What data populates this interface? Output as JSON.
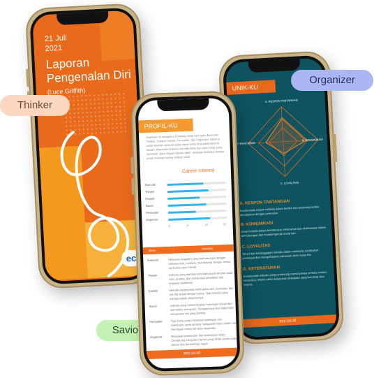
{
  "pills": {
    "thinker": "Thinker",
    "organizer": "Organizer",
    "savior": "Savior"
  },
  "cover": {
    "date_line1": "21 Juli",
    "date_line2": "2021",
    "title_line1": "Laporan",
    "title_line2": "Pengenalan Diri",
    "subtitle": "(Luce Griffith)",
    "logo": "ecc"
  },
  "profile": {
    "header": "PROFIL-KU",
    "intro": "Asesmen ini mengukur 6 bidang minat karir yaitu Executor, Thinker, Creator, Savior, Persuader, dan Organizer. Skormu untuk keenam area tersebut dapat kamu lihat pada tabel di bawah. Mayoritas individu memiliki lebih dari satu minat yang menonjol. Baca bagian bawah tabel, terdapat deskripsi singkat untuk masing-masing bidang minat.",
    "chart_title": "Career Interest",
    "chart_rows": [
      {
        "label": "Executor",
        "value": 0.62
      },
      {
        "label": "Thinker",
        "value": 0.7
      },
      {
        "label": "Creator",
        "value": 0.55
      },
      {
        "label": "Savior",
        "value": 0.66
      },
      {
        "label": "Persuader",
        "value": 0.48
      },
      {
        "label": "Organizer",
        "value": 0.72
      }
    ],
    "ticks": [
      "0",
      "5",
      "10",
      "15"
    ],
    "table_head": [
      "Minat",
      "Deskripsi"
    ],
    "table_rows": [
      {
        "k": "Executor",
        "v": "Menyukai kegiatan yang berhubungan dengan aktivitas fisik, mekanis, dan bekerja dengan mesin, tumbuhan atau hewan."
      },
      {
        "k": "Thinker",
        "v": "Individu yang memiliki kecenderungan tertarik pada riset, analisa, dan melakukan penelitian dan kegiatan akademis."
      },
      {
        "k": "Creator",
        "v": "Memiliki ketertarikan lebih pada seni, kesenian, dan hal-hal terkait dengan karya. Tipe individu yang menggunakan ekspresinya."
      },
      {
        "k": "Savior",
        "v": "Individu yang mementingkan hubungan sosial dan membantu orang lain. Perasaannya dari lingkungan merupakan hal yang penting."
      },
      {
        "k": "Persuader",
        "v": "Tipe orang yang menyukai tantangan dan memimpin, serta senang mengambil risiko dalam hal membujuk orang lain atau negosiasi."
      },
      {
        "k": "Organizer",
        "v": "Menyukai keteraturan dan keteraturan kerja. Cenderung menyukai hal-hal yang detail, patuh pada aturan dan berorientasi tugas."
      }
    ],
    "footer": "ecc.co.id"
  },
  "unik": {
    "header": "UNIK-KU",
    "axes": [
      "A. RESPON TANTANGAN",
      "B. KOMUNIKASI",
      "C. LOYALITAS",
      "D. KETERATURAN"
    ],
    "sections": [
      {
        "title": "A. RESPON TANTANGAN",
        "text": "Karakteristik respon individu dalam berfikir dan berkinerja ketika dihadapkan dengan persoalan."
      },
      {
        "title": "B. KOMUNIKASI",
        "text": "Minat individu dalam berinteraksi, kelincahan dan keleluasaan dalam berhubungan dan mempengaruhi orang lain."
      },
      {
        "title": "C. LOYALITAS",
        "text": "Tekad dan kesanggupan individu dalam membela, melakukan pekerjaan dan mengorbankan perasaan demi suatu hal."
      },
      {
        "title": "D. KETERATURAN",
        "text": "Karakteristik individu yang cenderung menunjukkan perilaku teratur, terstruktur, efisien serta melakukan pekerjaan yang berulang atau terpola."
      }
    ],
    "footer": "ecc.co.id"
  },
  "colors": {
    "orange": "#ea6a1c",
    "teal": "#0d5460",
    "bar_blue": "#34b5e4",
    "gold_frame": "#c9b48a"
  }
}
